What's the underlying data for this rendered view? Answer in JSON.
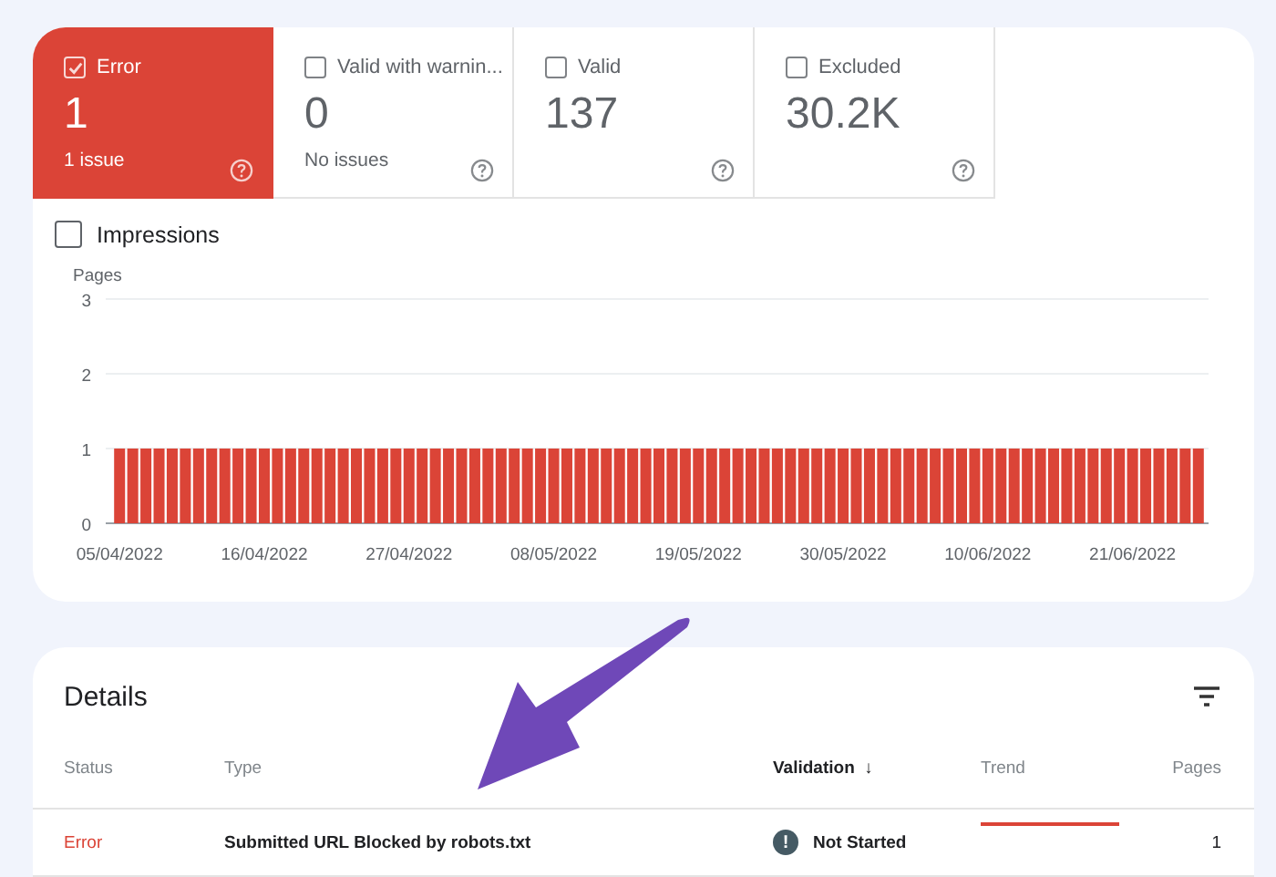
{
  "summary_tiles": [
    {
      "label": "Error",
      "count": "1",
      "caption": "1 issue",
      "selected": true
    },
    {
      "label": "Valid with warnin...",
      "count": "0",
      "caption": "No issues",
      "selected": false
    },
    {
      "label": "Valid",
      "count": "137",
      "selected": false
    },
    {
      "label": "Excluded",
      "count": "30.2K",
      "selected": false
    }
  ],
  "impressions": {
    "label": "Impressions",
    "checked": false
  },
  "chart_data": {
    "type": "bar",
    "ylabel": "Pages",
    "ylim": [
      0,
      3
    ],
    "yticks": [
      0,
      1,
      2,
      3
    ],
    "categories": [
      "05/04/2022",
      null,
      null,
      null,
      null,
      null,
      null,
      null,
      null,
      null,
      null,
      "16/04/2022",
      null,
      null,
      null,
      null,
      null,
      null,
      null,
      null,
      null,
      null,
      "27/04/2022",
      null,
      null,
      null,
      null,
      null,
      null,
      null,
      null,
      null,
      null,
      "08/05/2022",
      null,
      null,
      null,
      null,
      null,
      null,
      null,
      null,
      null,
      null,
      "19/05/2022",
      null,
      null,
      null,
      null,
      null,
      null,
      null,
      null,
      null,
      null,
      "30/05/2022",
      null,
      null,
      null,
      null,
      null,
      null,
      null,
      null,
      null,
      null,
      "10/06/2022",
      null,
      null,
      null,
      null,
      null,
      null,
      null,
      null,
      null,
      null,
      "21/06/2022",
      null,
      null,
      null,
      null,
      null
    ],
    "series": [
      {
        "color": "#db4437",
        "values": [
          1,
          1,
          1,
          1,
          1,
          1,
          1,
          1,
          1,
          1,
          1,
          1,
          1,
          1,
          1,
          1,
          1,
          1,
          1,
          1,
          1,
          1,
          1,
          1,
          1,
          1,
          1,
          1,
          1,
          1,
          1,
          1,
          1,
          1,
          1,
          1,
          1,
          1,
          1,
          1,
          1,
          1,
          1,
          1,
          1,
          1,
          1,
          1,
          1,
          1,
          1,
          1,
          1,
          1,
          1,
          1,
          1,
          1,
          1,
          1,
          1,
          1,
          1,
          1,
          1,
          1,
          1,
          1,
          1,
          1,
          1,
          1,
          1,
          1,
          1,
          1,
          1,
          1,
          1,
          1,
          1,
          1,
          1
        ]
      }
    ]
  },
  "details": {
    "title": "Details",
    "columns": [
      {
        "label": "Status",
        "sorted": false
      },
      {
        "label": "Type",
        "sorted": false
      },
      {
        "label": "Validation",
        "sorted": true,
        "sort_icon": "↓"
      },
      {
        "label": "Trend",
        "sorted": false
      },
      {
        "label": "Pages",
        "sorted": false
      }
    ],
    "rows": [
      {
        "status": "Error",
        "type": "Submitted URL Blocked by robots.txt",
        "validation_icon": "!",
        "validation": "Not Started",
        "pages": "1"
      }
    ]
  }
}
